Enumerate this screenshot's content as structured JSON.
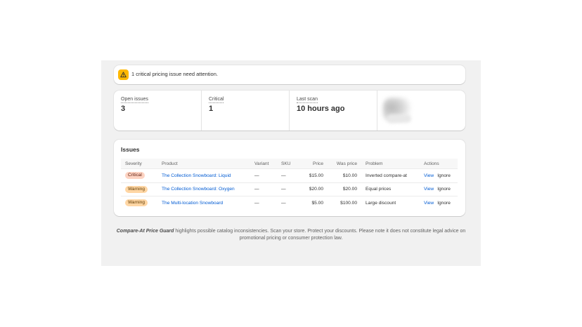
{
  "banner": {
    "icon": "warning-triangle-icon",
    "text": "1 critical pricing issue need attention.",
    "accent": "#ffb800"
  },
  "stats": [
    {
      "label": "Open issues",
      "value": "3"
    },
    {
      "label": "Critical",
      "value": "1"
    },
    {
      "label": "Last scan",
      "value": "10 hours ago"
    }
  ],
  "issues": {
    "title": "Issues",
    "columns": [
      "Severity",
      "Product",
      "Variant",
      "SKU",
      "Price",
      "Was price",
      "Problem",
      "Actions"
    ],
    "rows": [
      {
        "severity": "Critical",
        "severity_color": "#fdd3c2",
        "product": "The Collection Snowboard: Liquid",
        "variant": "—",
        "sku": "—",
        "price": "$15.00",
        "was_price": "$10.00",
        "problem": "Inverted compare-at",
        "view": "View",
        "ignore": "Ignore"
      },
      {
        "severity": "Warning",
        "severity_color": "#ffd6a4",
        "product": "The Collection Snowboard: Oxygen",
        "variant": "—",
        "sku": "—",
        "price": "$20.00",
        "was_price": "$20.00",
        "problem": "Equal prices",
        "view": "View",
        "ignore": "Ignore"
      },
      {
        "severity": "Warning",
        "severity_color": "#ffd6a4",
        "product": "The Multi-location Snowboard",
        "variant": "—",
        "sku": "—",
        "price": "$5.00",
        "was_price": "$100.00",
        "problem": "Large discount",
        "view": "View",
        "ignore": "Ignore"
      }
    ]
  },
  "footer": {
    "brand": "Compare-At Price Guard",
    "text": " highlights possible catalog inconsistencies. Scan your store. Protect your discounts. Please note it does not constitute legal advice on promotional pricing or consumer protection law."
  },
  "colors": {
    "link": "#005bd3",
    "background": "#f1f1f1"
  }
}
